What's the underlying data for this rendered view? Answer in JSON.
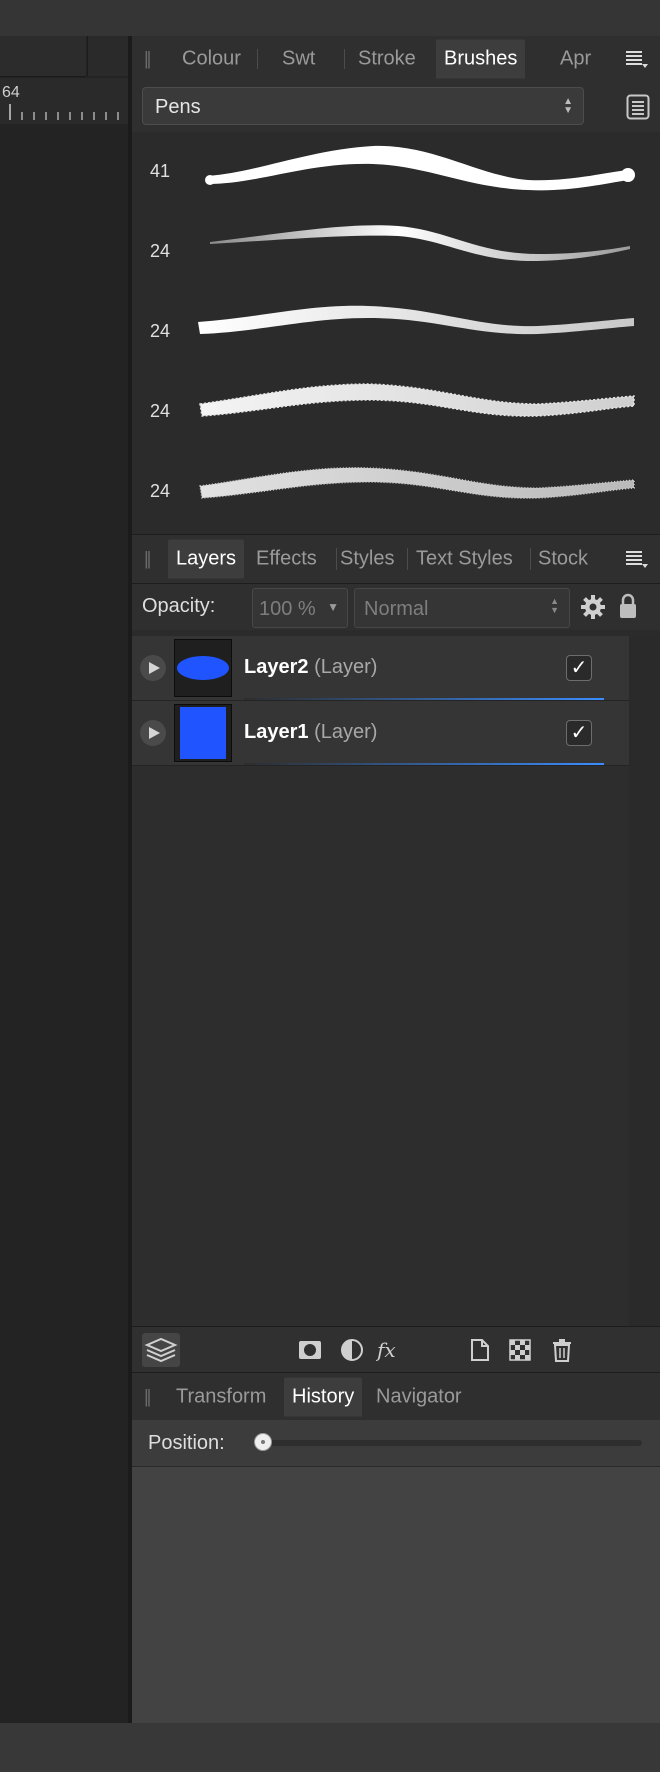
{
  "ruler": {
    "label": "64"
  },
  "colour_panel": {
    "tabs": [
      {
        "label": "Colour",
        "active": false
      },
      {
        "label": "Swt",
        "active": false
      },
      {
        "label": "Stroke",
        "active": false
      },
      {
        "label": "Brushes",
        "active": true
      },
      {
        "label": "Apr",
        "active": false
      }
    ],
    "category": "Pens",
    "brushes": [
      {
        "size": "41",
        "style": "solid-taper"
      },
      {
        "size": "24",
        "style": "gradient-taper"
      },
      {
        "size": "24",
        "style": "rough-soft"
      },
      {
        "size": "24",
        "style": "rough-textured"
      },
      {
        "size": "24",
        "style": "rough-grainy"
      }
    ]
  },
  "layers_panel": {
    "tabs": [
      {
        "label": "Layers",
        "active": true
      },
      {
        "label": "Effects",
        "active": false
      },
      {
        "label": "Styles",
        "active": false
      },
      {
        "label": "Text Styles",
        "active": false
      },
      {
        "label": "Stock",
        "active": false
      }
    ],
    "opacity_label": "Opacity:",
    "opacity_value": "100 %",
    "blend_mode": "Normal",
    "layers": [
      {
        "name": "Layer2",
        "type": "(Layer)",
        "visible": true,
        "thumb_shape": "ellipse",
        "thumb_color": "#1f54ff"
      },
      {
        "name": "Layer1",
        "type": "(Layer)",
        "visible": true,
        "thumb_shape": "rectangle",
        "thumb_color": "#1f54ff"
      }
    ],
    "check_mark": "✓"
  },
  "history_panel": {
    "tabs": [
      {
        "label": "Transform",
        "active": false
      },
      {
        "label": "History",
        "active": true
      },
      {
        "label": "Navigator",
        "active": false
      }
    ],
    "position_label": "Position:",
    "position_value": 0
  },
  "colors": {
    "accent": "#3a8dff",
    "layer_fill": "#1f54ff"
  }
}
